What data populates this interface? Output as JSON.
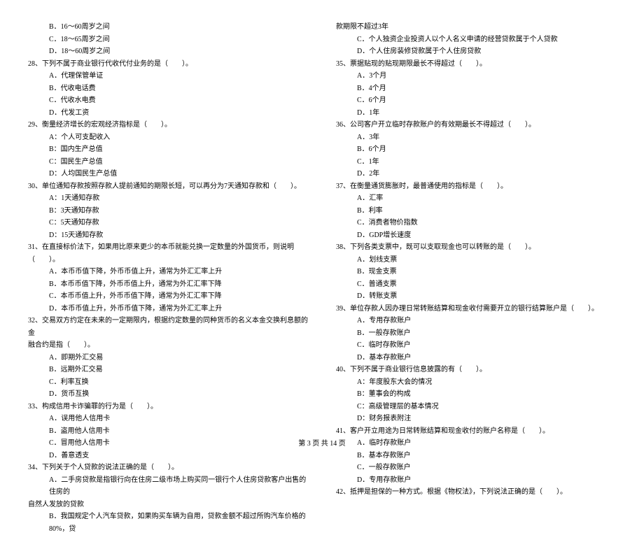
{
  "left": {
    "o27b": "B．16～60周岁之间",
    "o27c": "C．18～65周岁之间",
    "o27d": "D．18～60周岁之间",
    "q28": "28、下列不属于商业银行代收代付业务的是（　　）。",
    "o28a": "A．代理保管单证",
    "o28b": "B．代收电话费",
    "o28c": "C．代收水电费",
    "o28d": "D．代发工资",
    "q29": "29、衡量经济增长的宏观经济指标是（　　）。",
    "o29a": "A：个人可支配收入",
    "o29b": "B：国内生产总值",
    "o29c": "C：国民生产总值",
    "o29d": "D：人均国民生产总值",
    "q30": "30、单位通知存款按照存款人提前通知的期限长短，可以再分为7天通知存款和（　　）。",
    "o30a": "A：1天通知存款",
    "o30b": "B：3天通知存款",
    "o30c": "C：5天通知存款",
    "o30d": "D：15天通知存款",
    "q31a": "31、在直接标价法下，如果用比原来更少的本币就能兑换一定数量的外国货币，则说明",
    "q31b": "（　　）。",
    "o31a": "A．本币币值下降，外币币值上升，通常为外汇汇率上升",
    "o31b": "B．本币币值下降，外币币值上升，通常为外汇汇率下降",
    "o31c": "C．本币币值上升，外币币值下降，通常为外汇汇率下降",
    "o31d": "D．本币币值上升，外币币值下降，通常为外汇汇率上升",
    "q32a": "32、交易双方约定在未来的一定期限内，根据约定数量的同种货币的名义本金交换利息额的金",
    "q32b": "融合约是指（　　）。",
    "o32a": "A．即期外汇交易",
    "o32b": "B．远期外汇交易",
    "o32c": "C．利率互换",
    "o32d": "D．货币互换",
    "q33": "33、构成信用卡诈骗罪的行为是（　　）。",
    "o33a": "A．误用他人信用卡",
    "o33b": "B．盗用他人信用卡",
    "o33c": "C．冒用他人信用卡",
    "o33d": "D．善意透支",
    "q34": "34、下列关于个人贷款的说法正确的是（　　）。",
    "o34a": "A．二手房贷款是指银行向在住房二级市场上购买同一银行个人住房贷款客户出售的住房的",
    "o34ab": "自然人发放的贷款",
    "o34b": "B．我国规定个人汽车贷款，如果购买车辆为自用，贷款金额不超过所购汽车价格的80%，贷"
  },
  "right": {
    "o34bc": "款期限不超过3年",
    "o34c": "C．个人独资企业投资人以个人名义申请的经营贷款属于个人贷款",
    "o34d": "D．个人住房装修贷款属于个人住房贷款",
    "q35": "35、票据贴现的贴现期限最长不得超过（　　）。",
    "o35a": "A．3个月",
    "o35b": "B．4个月",
    "o35c": "C．6个月",
    "o35d": "D．1年",
    "q36": "36、公司客户开立临时存款账户的有效期最长不得超过（　　）。",
    "o36a": "A．3年",
    "o36b": "B．6个月",
    "o36c": "C．1年",
    "o36d": "D．2年",
    "q37": "37、在衡量通货膨胀时，最普通使用的指标是（　　）。",
    "o37a": "A．汇率",
    "o37b": "B．利率",
    "o37c": "C．消费者物价指数",
    "o37d": "D．GDP增长速度",
    "q38": "38、下列各类支票中，既可以支取现金也可以转账的是（　　）。",
    "o38a": "A．划线支票",
    "o38b": "B．现金支票",
    "o38c": "C．普通支票",
    "o38d": "D．转账支票",
    "q39": "39、单位存款人因办理日常转账结算和现金收付需要开立的银行结算账户是（　　）。",
    "o39a": "A．专用存款账户",
    "o39b": "B．一般存款账户",
    "o39c": "C．临时存款账户",
    "o39d": "D．基本存款账户",
    "q40": "40、下列不属于商业银行信息披露的有（　　）。",
    "o40a": "A：年度股东大会的情况",
    "o40b": "B：董事会的构成",
    "o40c": "C：高级管理层的基本情况",
    "o40d": "D：财务报表附注",
    "q41": "41、客户开立用途为日常转账结算和现金收付的账户名称是（　　）。",
    "o41a": "A．临时存款账户",
    "o41b": "B．基本存款账户",
    "o41c": "C．一般存款账户",
    "o41d": "D．专用存款账户",
    "q42": "42、抵押是担保的一种方式。根据《物权法》，下列说法正确的是（　　）。"
  },
  "footer": "第 3 页 共 14 页"
}
